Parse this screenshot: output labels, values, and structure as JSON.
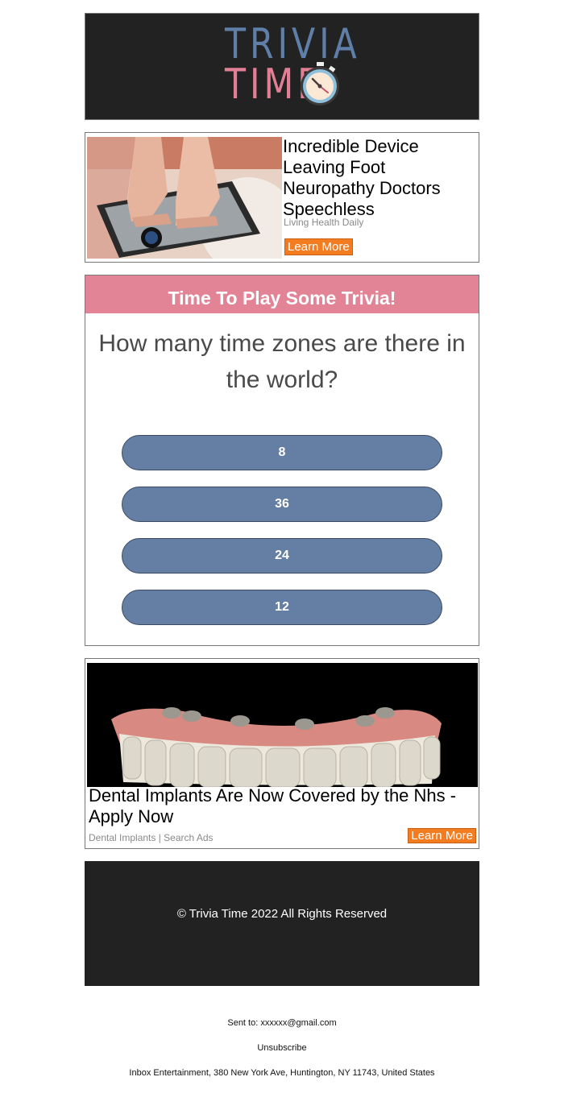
{
  "header": {
    "logo_line1": "TRIVIA",
    "logo_line2": "TIME",
    "logo_icon": "stopwatch-icon"
  },
  "ad1": {
    "title": "Incredible Device Leaving Foot Neuropathy Doctors Speechless",
    "source": "Living Health Daily",
    "button": "Learn More",
    "image": "foot-massager-image"
  },
  "trivia": {
    "heading": "Time To Play Some Trivia!",
    "question": "How many time zones are there in the world?",
    "answers": [
      "8",
      "36",
      "24",
      "12"
    ]
  },
  "ad2": {
    "title": "Dental Implants Are Now Covered by the Nhs - Apply Now",
    "source": "Dental Implants | Search Ads",
    "button": "Learn More",
    "image": "dental-implants-image"
  },
  "footer": {
    "copyright": "© Trivia Time 2022 All Rights Reserved"
  },
  "meta": {
    "sent_to": "Sent to: xxxxxx@gmail.com",
    "unsubscribe": "Unsubscribe",
    "address": "Inbox Entertainment, 380 New York Ave, Huntington, NY 11743, United States"
  },
  "colors": {
    "header_bg": "#222222",
    "pink": "#e38396",
    "blue": "#5f7fa8",
    "answer_bg": "#657ea3",
    "cta": "#f37b20"
  }
}
